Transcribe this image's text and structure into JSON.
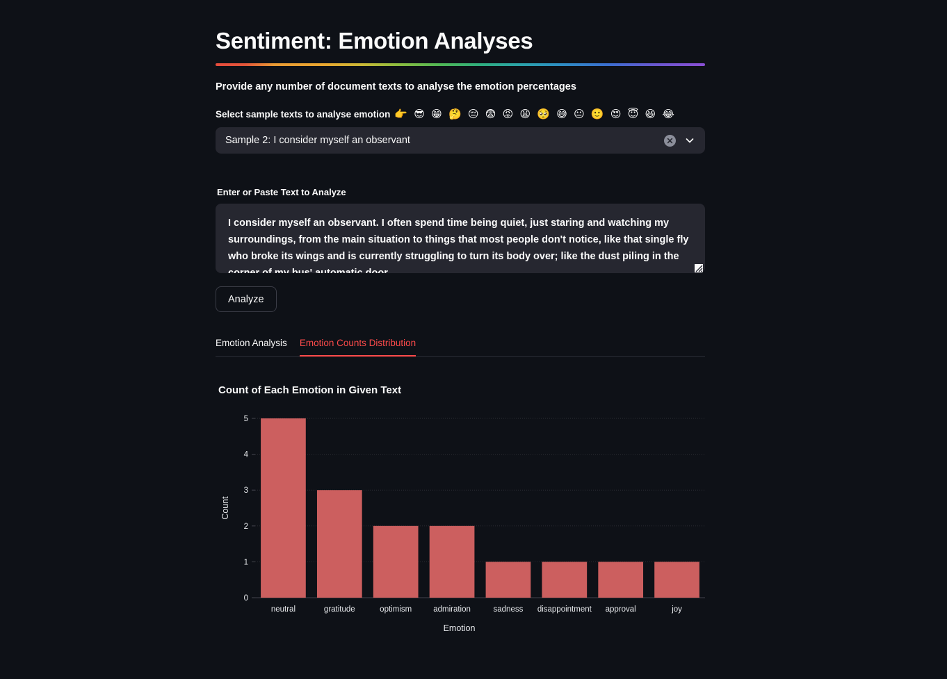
{
  "header": {
    "title": "Sentiment: Emotion Analyses",
    "subtitle": "Provide any number of document texts to analyse the emotion percentages"
  },
  "select_section": {
    "label": "Select sample texts to analyse emotion",
    "emoji": "👉 😎 😁 🤔 😔 😨 😡 😩 🥺 😅 😐 🙂 😍 😇 😆 😂",
    "selected_value": "Sample 2: I consider myself an observant",
    "clear_icon": "clear-circle-icon",
    "chevron_icon": "chevron-down-icon"
  },
  "textarea_section": {
    "label": "Enter or Paste Text to Analyze",
    "value": "I consider myself an observant. I often spend time being quiet, just staring and watching my surroundings, from the main situation to things that most people don't notice, like that single fly who broke its wings and is currently struggling to turn its body over; like the dust piling in the corner of my bus' automatic door."
  },
  "actions": {
    "analyze_label": "Analyze"
  },
  "tabs": [
    {
      "label": "Emotion Analysis",
      "active": false
    },
    {
      "label": "Emotion Counts Distribution",
      "active": true
    }
  ],
  "colors": {
    "background": "#0E1117",
    "surface": "#262730",
    "accent": "#FF4B4B",
    "bar": "#CC5F5F",
    "text": "#FAFAFA",
    "grid": "#45474F"
  },
  "chart_data": {
    "type": "bar",
    "title": "Count of Each Emotion in Given Text",
    "xlabel": "Emotion",
    "ylabel": "Count",
    "categories": [
      "neutral",
      "gratitude",
      "optimism",
      "admiration",
      "sadness",
      "disappointment",
      "approval",
      "joy"
    ],
    "values": [
      5,
      3,
      2,
      2,
      1,
      1,
      1,
      1
    ],
    "yticks": [
      0,
      1,
      2,
      3,
      4,
      5
    ],
    "ylim": [
      0,
      5
    ],
    "grid": true,
    "legend": false,
    "bar_color": "#CC5F5F"
  }
}
